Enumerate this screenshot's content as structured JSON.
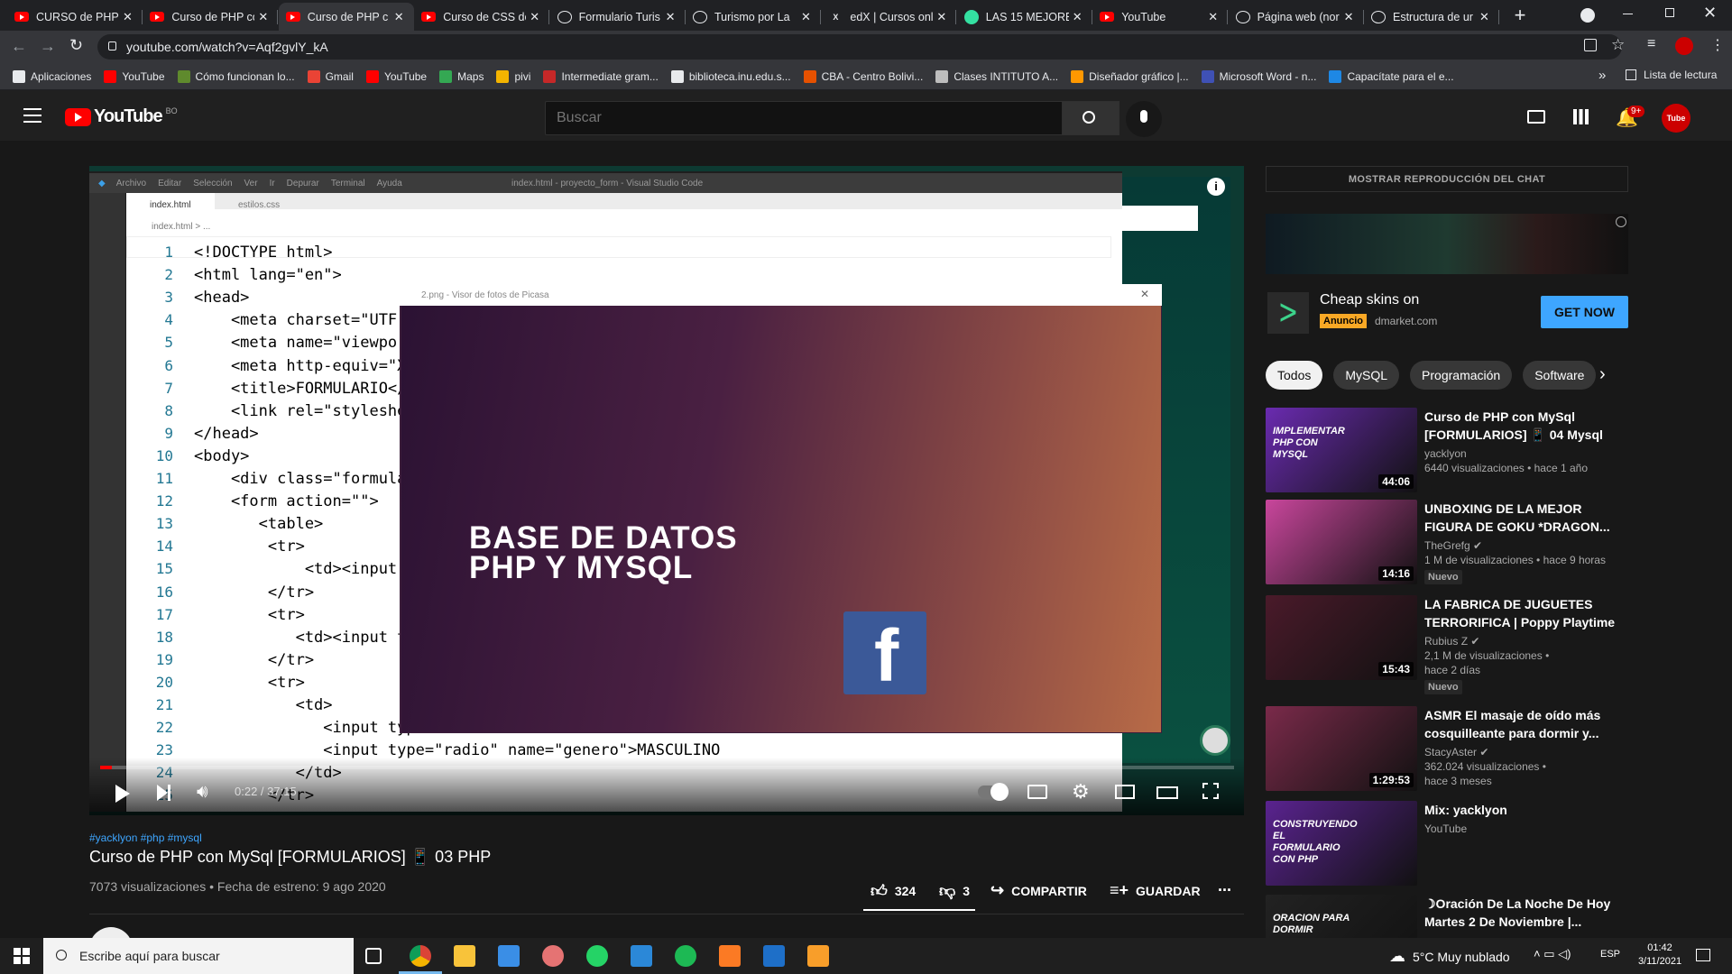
{
  "browser": {
    "tabs": [
      {
        "title": "CURSO de PHP |",
        "fav": "youtube",
        "active": false
      },
      {
        "title": "Curso de PHP co",
        "fav": "youtube",
        "active": false
      },
      {
        "title": "Curso de PHP c",
        "fav": "youtube",
        "active": true
      },
      {
        "title": "Curso de CSS de",
        "fav": "youtube",
        "active": false
      },
      {
        "title": "Formulario Turis",
        "fav": "globe",
        "active": false
      },
      {
        "title": "Turismo por La",
        "fav": "globe",
        "active": false
      },
      {
        "title": "edX | Cursos onl",
        "fav": "edx",
        "active": false
      },
      {
        "title": "LAS 15 MEJORE",
        "fav": "tripadvisor",
        "active": false
      },
      {
        "title": "YouTube",
        "fav": "youtube",
        "active": false
      },
      {
        "title": "Página web (nor",
        "fav": "globe",
        "active": false
      },
      {
        "title": "Estructura de ur",
        "fav": "globe",
        "active": false
      }
    ],
    "new_tab": "+",
    "url": "youtube.com/watch?v=Aqf2gvlY_kA",
    "bookmarks": [
      {
        "label": "Aplicaciones",
        "color": "#e8eaed"
      },
      {
        "label": "YouTube",
        "color": "#ff0000"
      },
      {
        "label": "Cómo funcionan lo...",
        "color": "#5f8a2d"
      },
      {
        "label": "Gmail",
        "color": "#ea4335"
      },
      {
        "label": "YouTube",
        "color": "#ff0000"
      },
      {
        "label": "Maps",
        "color": "#34a853"
      },
      {
        "label": "pivi",
        "color": "#f4b400"
      },
      {
        "label": "Intermediate gram...",
        "color": "#c62828"
      },
      {
        "label": "biblioteca.inu.edu.s...",
        "color": "#e8eaed"
      },
      {
        "label": "CBA - Centro Bolivi...",
        "color": "#e65100"
      },
      {
        "label": "Clases INTITUTO A...",
        "color": "#bdbdbd"
      },
      {
        "label": "Diseñador gráfico |...",
        "color": "#ff9800"
      },
      {
        "label": "Microsoft Word - n...",
        "color": "#3f51b5"
      },
      {
        "label": "Capacítate para el e...",
        "color": "#1e88e5"
      }
    ],
    "bookmarks_more": "»",
    "reading_list": "Lista de lectura"
  },
  "youtube": {
    "logo": "YouTube",
    "country": "BO",
    "search_placeholder": "Buscar",
    "notif_count": "9+",
    "avatar_text": "Tube"
  },
  "video": {
    "vscode_menu": [
      "Archivo",
      "Editar",
      "Selección",
      "Ver",
      "Ir",
      "Depurar",
      "Terminal",
      "Ayuda"
    ],
    "vscode_title": "index.html - proyecto_form - Visual Studio Code",
    "vscode_tabs": [
      "index.html",
      "estilos.css"
    ],
    "breadcrumb": "index.html > ...",
    "code_lines": [
      {
        "n": "1",
        "t": "<!DOCTYPE html>"
      },
      {
        "n": "2",
        "t": "<html lang=\"en\">"
      },
      {
        "n": "3",
        "t": "<head>"
      },
      {
        "n": "4",
        "t": "    <meta charset=\"UTF-"
      },
      {
        "n": "5",
        "t": "    <meta name=\"viewpor"
      },
      {
        "n": "6",
        "t": "    <meta http-equiv=\"X"
      },
      {
        "n": "7",
        "t": "    <title>FORMULARIO</"
      },
      {
        "n": "8",
        "t": "    <link rel=\"styleshe"
      },
      {
        "n": "9",
        "t": "</head>"
      },
      {
        "n": "10",
        "t": "<body>"
      },
      {
        "n": "11",
        "t": "    <div class=\"formula"
      },
      {
        "n": "12",
        "t": "    <form action=\"\">"
      },
      {
        "n": "13",
        "t": "       <table>"
      },
      {
        "n": "14",
        "t": "        <tr>"
      },
      {
        "n": "15",
        "t": "            <td><input"
      },
      {
        "n": "16",
        "t": "        </tr>"
      },
      {
        "n": "17",
        "t": "        <tr>"
      },
      {
        "n": "18",
        "t": "           <td><input t"
      },
      {
        "n": "19",
        "t": "        </tr>"
      },
      {
        "n": "20",
        "t": "        <tr>"
      },
      {
        "n": "21",
        "t": "           <td>"
      },
      {
        "n": "22",
        "t": "              <input type"
      },
      {
        "n": "23",
        "t": "              <input type=\"radio\" name=\"genero\">MASCULINO"
      },
      {
        "n": "24",
        "t": "           </td>"
      },
      {
        "n": "25",
        "t": "        </tr>"
      }
    ],
    "picasa_title": "2.png - Visor de fotos de Picasa",
    "slide_text_line1": "BASE DE DATOS",
    "slide_text_line2": "PHP  Y MYSQL",
    "facebook_letter": "f",
    "time_current": "0:22",
    "time_total": "37:15",
    "progress": 0.01
  },
  "info": {
    "hashtags": "#yacklyon #php #mysql",
    "title": "Curso de PHP con MySql [FORMULARIOS] 📱 03 PHP",
    "views": "7073 visualizaciones",
    "premiere": "Fecha de estreno: 9 ago 2020",
    "likes": "324",
    "dislikes": "3",
    "share": "COMPARTIR",
    "save": "GUARDAR",
    "more": "..."
  },
  "sidebar": {
    "chat_replay": "MOSTRAR REPRODUCCIÓN DEL CHAT",
    "ad": {
      "title": "Cheap skins on",
      "badge": "Anuncio",
      "domain": "dmarket.com",
      "cta": "GET NOW"
    },
    "chips": [
      "Todos",
      "MySQL",
      "Programación",
      "Software"
    ],
    "recs": [
      {
        "title": "Curso de PHP con MySql [FORMULARIOS] 📱 04 Mysql",
        "channel": "yacklyon",
        "meta": "6440 visualizaciones • hace 1 año",
        "meta2": "",
        "duration": "44:06",
        "badge": "",
        "thumb_text": "IMPLEMENTAR PHP CON MYSQL",
        "thumb_bg": "#6a2bb0",
        "verified": false
      },
      {
        "title": "UNBOXING DE LA MEJOR FIGURA DE GOKU *DRAGON...",
        "channel": "TheGrefg",
        "meta": "1 M de visualizaciones • hace 9 horas",
        "meta2": "",
        "duration": "14:16",
        "badge": "Nuevo",
        "thumb_text": "",
        "thumb_bg": "#c9469c",
        "verified": true
      },
      {
        "title": "LA FABRICA DE JUGUETES TERRORIFICA | Poppy Playtime",
        "channel": "Rubius Z",
        "meta": "2,1 M de visualizaciones •",
        "meta2": "hace 2 días",
        "duration": "15:43",
        "badge": "Nuevo",
        "thumb_text": "",
        "thumb_bg": "#4a1a2a",
        "verified": true
      },
      {
        "title": "ASMR El masaje de oído más cosquilleante para dormir y...",
        "channel": "StacyAster",
        "meta": "362.024 visualizaciones •",
        "meta2": "hace 3 meses",
        "duration": "1:29:53",
        "badge": "",
        "thumb_text": "",
        "thumb_bg": "#7a2a4a",
        "verified": true
      },
      {
        "title": "Mix: yacklyon",
        "channel": "YouTube",
        "meta": "",
        "meta2": "",
        "duration": "",
        "badge": "",
        "thumb_text": "CONSTRUYENDO EL FORMULARIO CON PHP",
        "thumb_bg": "#5a2390",
        "verified": false
      },
      {
        "title": "☽Oración De La Noche De Hoy Martes 2 De Noviembre |...",
        "channel": "",
        "meta": "",
        "meta2": "",
        "duration": "",
        "badge": "",
        "thumb_text": "ORACION PARA DORMIR",
        "thumb_bg": "#222",
        "verified": false
      }
    ]
  },
  "taskbar": {
    "search_placeholder": "Escribe aquí para buscar",
    "weather": "5°C  Muy nublado",
    "lang": "ESP",
    "time": "01:42",
    "date": "3/11/2021"
  },
  "colors": {
    "accent": "#ff0000",
    "link": "#3ea6ff",
    "ad_cta": "#3ea6ff",
    "ad_badge": "#f9a825"
  }
}
